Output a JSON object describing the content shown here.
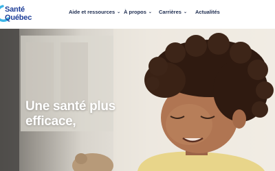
{
  "brand": {
    "line1": "Santé",
    "line2": "Québec",
    "color": "#1f3f99",
    "accent": "#3cb4e6"
  },
  "nav": {
    "items": [
      {
        "label": "Aide et ressources",
        "has_dropdown": true
      },
      {
        "label": "À propos",
        "has_dropdown": true
      },
      {
        "label": "Carrières",
        "has_dropdown": true
      },
      {
        "label": "Actualités",
        "has_dropdown": false
      }
    ],
    "chevron": "⌄"
  },
  "hero": {
    "headline_line1": "Une santé plus",
    "headline_line2": "efficace,"
  }
}
